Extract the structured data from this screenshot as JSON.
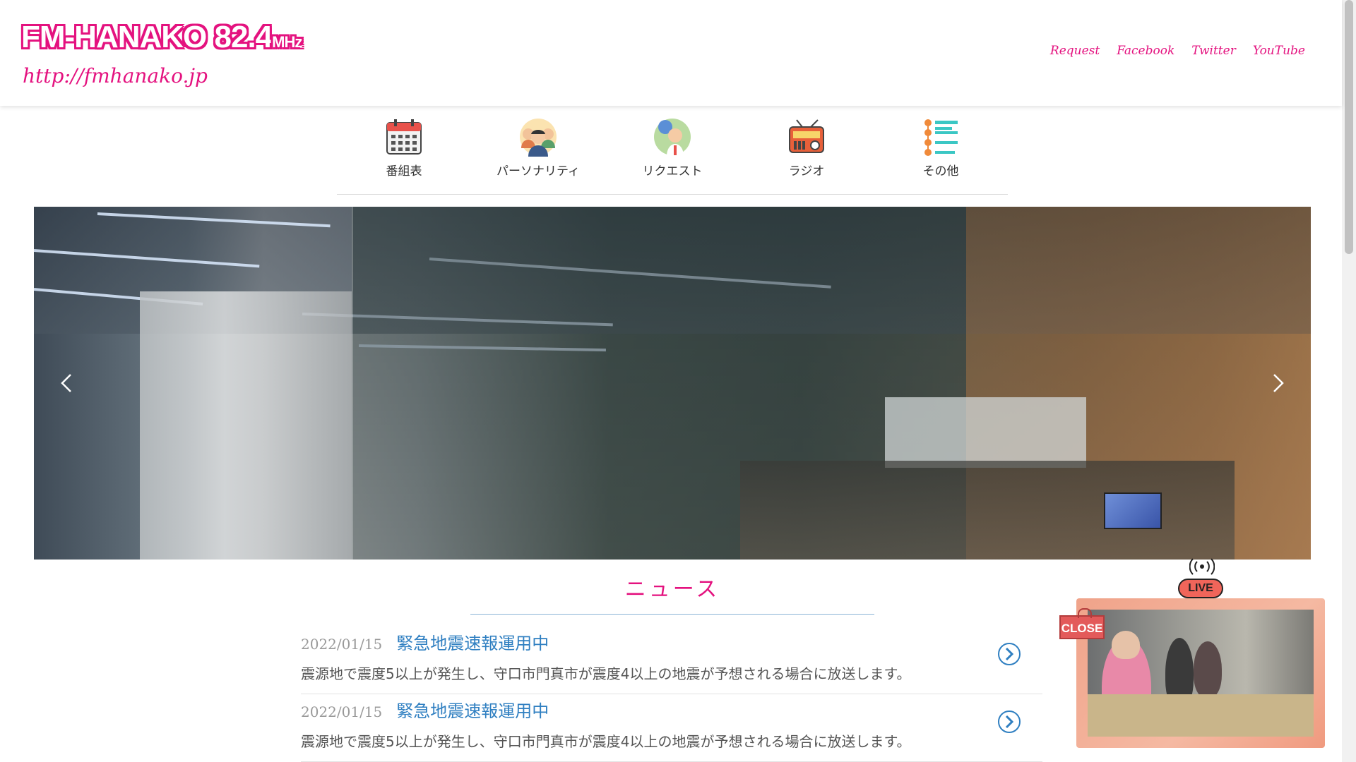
{
  "header": {
    "logo_text": "FM-HANAKO 82.4",
    "logo_unit": "MHz",
    "logo_url": "http://fmhanako.jp",
    "links": [
      "Request",
      "Facebook",
      "Twitter",
      "YouTube"
    ]
  },
  "nav": {
    "items": [
      {
        "label": "番組表",
        "icon": "calendar-icon"
      },
      {
        "label": "パーソナリティ",
        "icon": "people-icon"
      },
      {
        "label": "リクエスト",
        "icon": "request-person-icon"
      },
      {
        "label": "ラジオ",
        "icon": "radio-icon"
      },
      {
        "label": "その他",
        "icon": "list-icon"
      }
    ]
  },
  "news": {
    "title": "ニュース",
    "items": [
      {
        "date": "2022/01/15",
        "title": "緊急地震速報運用中",
        "body": "震源地で震度5以上が発生し、守口市門真市が震度4以上の地震が予想される場合に放送します。"
      },
      {
        "date": "2022/01/15",
        "title": "緊急地震速報運用中",
        "body": "震源地で震度5以上が発生し、守口市門真市が震度4以上の地震が予想される場合に放送します。"
      }
    ]
  },
  "live": {
    "badge": "LIVE",
    "close_label": "CLOSE"
  },
  "colors": {
    "brand": "#e4127f",
    "link": "#2f7fc1"
  }
}
